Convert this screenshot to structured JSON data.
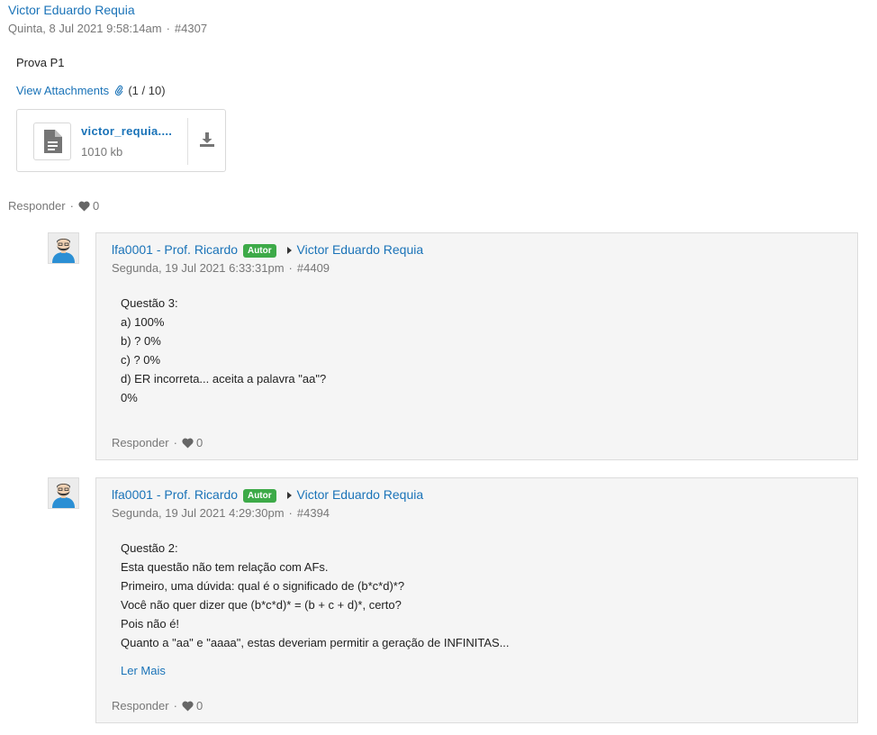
{
  "post": {
    "author": "Victor Eduardo Requia",
    "date": "Quinta, 8 Jul 2021 9:58:14am",
    "id": "#4307",
    "body": "Prova P1",
    "attachments_link": "View Attachments",
    "attachments_count": "(1 / 10)",
    "file": {
      "name": "victor_requia....",
      "size": "1010 kb"
    },
    "reply_label": "Responder",
    "likes": "0"
  },
  "replies": [
    {
      "author": "lfa0001 - Prof. Ricardo",
      "badge": "Autor",
      "reply_to": "Victor Eduardo Requia",
      "date": "Segunda, 19 Jul 2021 6:33:31pm",
      "id": "#4409",
      "lines": [
        "Questão 3:",
        "a) 100%",
        "b) ? 0%",
        "c) ? 0%",
        "d) ER incorreta... aceita a palavra \"aa\"?",
        "0%"
      ],
      "reply_label": "Responder",
      "likes": "0"
    },
    {
      "author": "lfa0001 - Prof. Ricardo",
      "badge": "Autor",
      "reply_to": "Victor Eduardo Requia",
      "date": "Segunda, 19 Jul 2021 4:29:30pm",
      "id": "#4394",
      "lines": [
        "Questão 2:",
        "Esta questão não tem relação com AFs.",
        "Primeiro, uma dúvida: qual é o significado de (b*c*d)*?",
        "Você não quer dizer que (b*c*d)* = (b + c + d)*, certo?",
        "Pois não é!",
        "Quanto a \"aa\" e \"aaaa\", estas deveriam permitir a geração de INFINITAS..."
      ],
      "read_more": "Ler Mais",
      "reply_label": "Responder",
      "likes": "0"
    }
  ],
  "colors": {
    "link": "#1a73b8",
    "badge": "#3daa48",
    "panel_bg": "#f5f5f5",
    "muted": "#777777"
  },
  "icons": [
    "paperclip-icon",
    "file-document-icon",
    "download-icon",
    "heart-icon",
    "caret-right-icon",
    "user-avatar-icon"
  ]
}
